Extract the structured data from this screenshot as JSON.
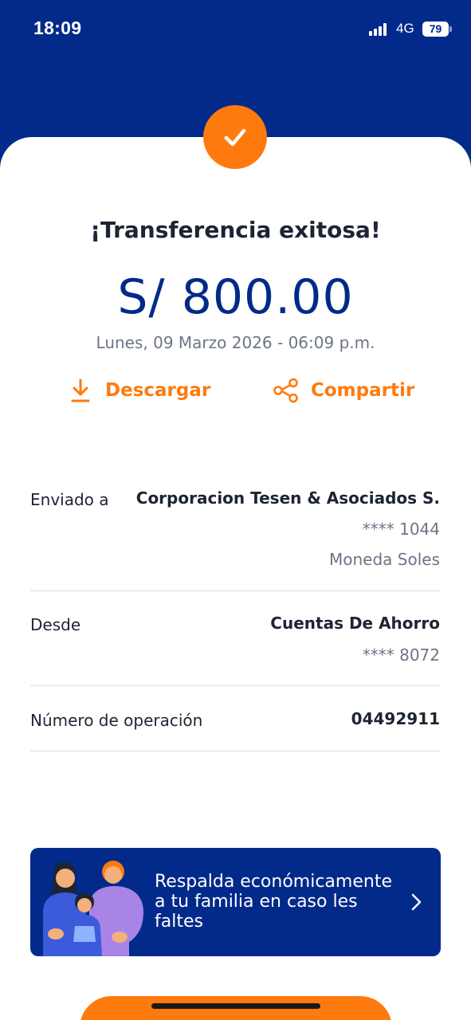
{
  "status_bar": {
    "time": "18:09",
    "network": "4G",
    "battery": "79"
  },
  "receipt": {
    "title": "¡Transferencia exitosa!",
    "amount": "S/ 800.00",
    "date": "Lunes, 09 Marzo 2026 - 06:09 p.m.",
    "download_label": "Descargar",
    "share_label": "Compartir"
  },
  "details": {
    "sent_to": {
      "label": "Enviado a",
      "name": "Corporacion Tesen & Asociados S.",
      "account": "**** 1044",
      "currency": "Moneda Soles"
    },
    "from": {
      "label": "Desde",
      "account_type": "Cuentas De Ahorro",
      "account": "**** 8072"
    },
    "operation": {
      "label": "Número de operación",
      "number": "04492911"
    }
  },
  "promo": {
    "text": "Respalda económicamente a tu familia en caso les faltes"
  },
  "colors": {
    "brand_blue": "#022a8a",
    "accent_orange": "#ff7a0d"
  },
  "icons": [
    "check-icon",
    "download-icon",
    "share-icon",
    "chevron-right-icon",
    "signal-icon",
    "battery-icon"
  ]
}
